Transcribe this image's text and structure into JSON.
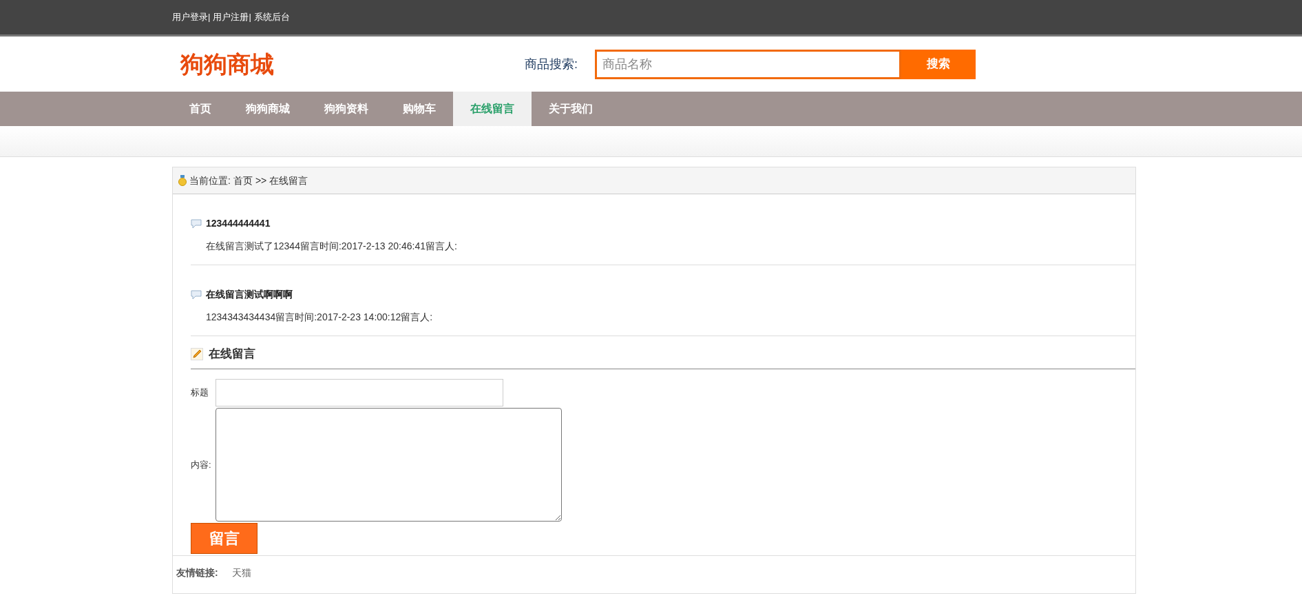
{
  "top_links": [
    "用户登录|",
    "用户注册|",
    "系统后台"
  ],
  "logo": "狗狗商城",
  "search": {
    "label": "商品搜索:",
    "placeholder": "商品名称",
    "button": "搜索"
  },
  "nav": [
    {
      "label": "首页",
      "selected": false
    },
    {
      "label": "狗狗商城",
      "selected": false
    },
    {
      "label": "狗狗资料",
      "selected": false
    },
    {
      "label": "购物车",
      "selected": false
    },
    {
      "label": "在线留言",
      "selected": true
    },
    {
      "label": "关于我们",
      "selected": false
    }
  ],
  "breadcrumb": {
    "label": "当前位置:",
    "items": [
      "首页",
      ">>",
      "在线留言"
    ]
  },
  "messages": [
    {
      "title": "123444444441",
      "body": "在线留言测试了12344留言时间:2017-2-13 20:46:41留言人:"
    },
    {
      "title": "在线留言测试啊啊啊",
      "body": "1234343434434留言时间:2017-2-23 14:00:12留言人:"
    }
  ],
  "form": {
    "heading": "在线留言",
    "title_label": "标题",
    "content_label": "内容:",
    "submit": "留言"
  },
  "footer": {
    "label": "友情链接:",
    "links": [
      "天猫"
    ]
  }
}
